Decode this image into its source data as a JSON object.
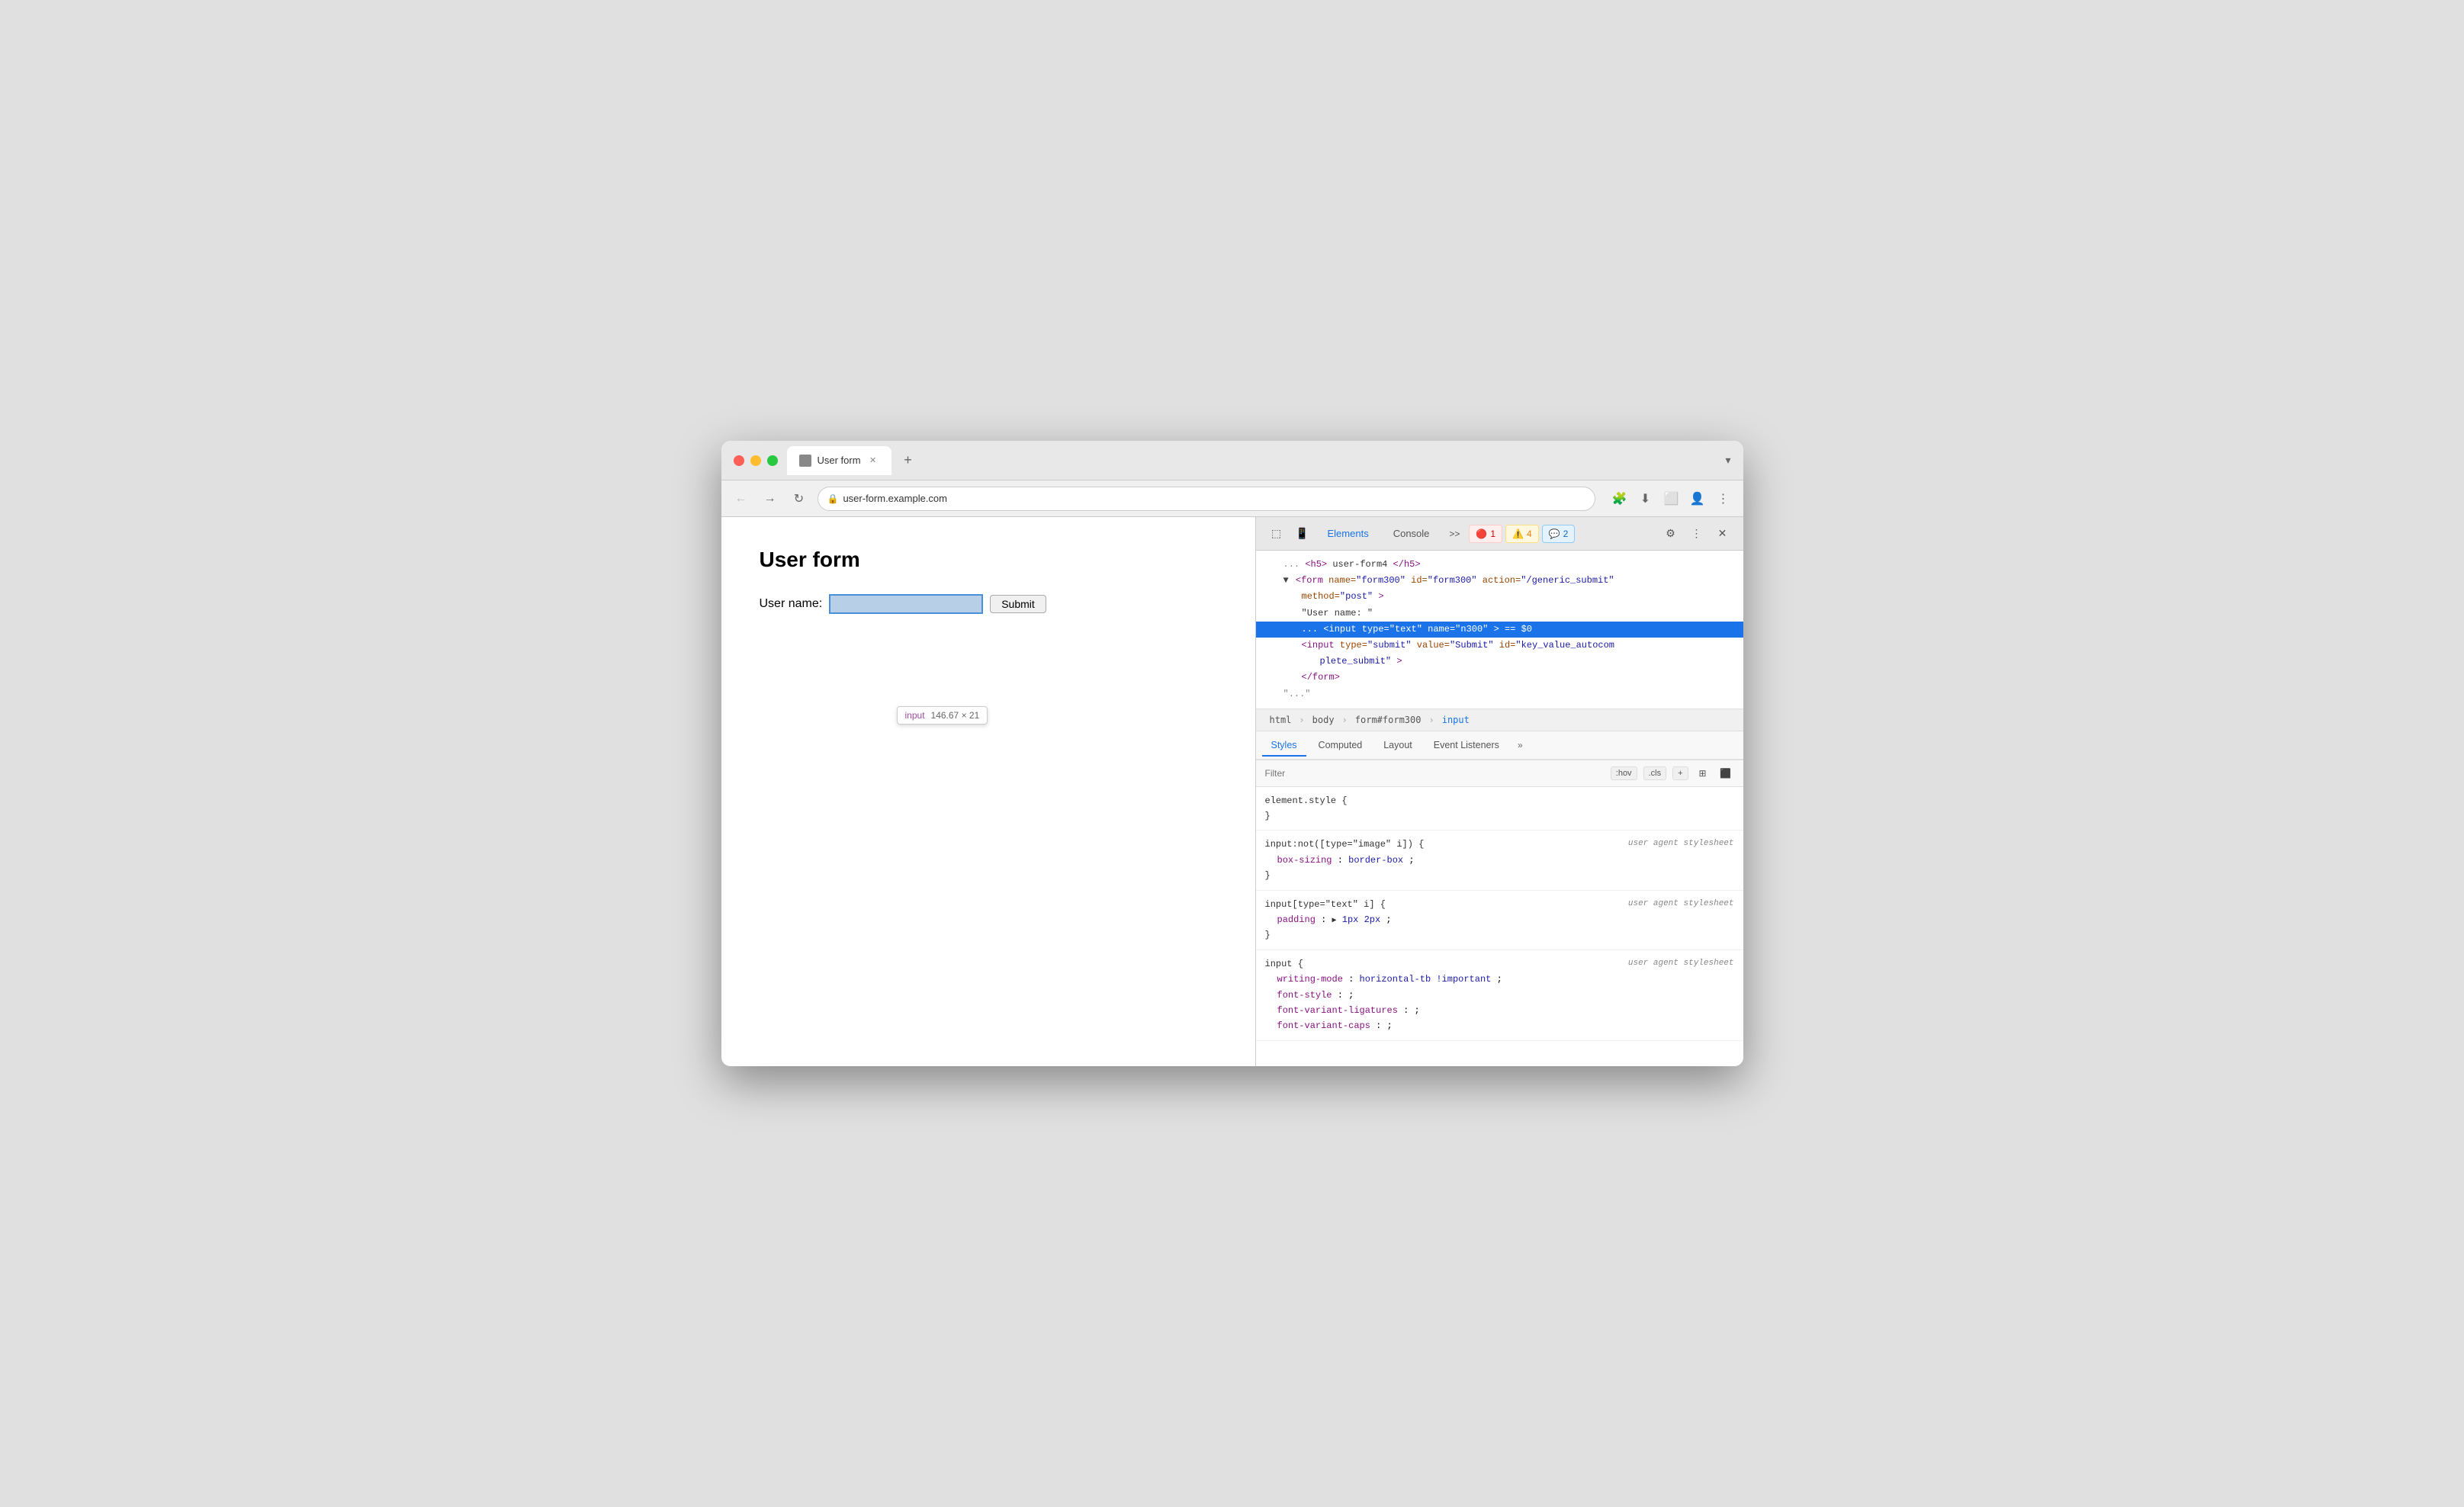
{
  "browser": {
    "tab_title": "User form",
    "tab_new_label": "+",
    "url": "user-form.example.com",
    "tab_menu_label": "▾"
  },
  "page": {
    "title": "User form",
    "form_label": "User name:",
    "submit_label": "Submit"
  },
  "tooltip": {
    "tag": "input",
    "dimensions": "146.67 × 21"
  },
  "devtools": {
    "tab_elements": "Elements",
    "tab_console": "Console",
    "badge_error_count": "1",
    "badge_warn_count": "4",
    "badge_info_count": "2",
    "more_tabs": ">>",
    "dom_lines": [
      {
        "text": "<h5> user-form4/h5>",
        "indent": 1,
        "highlighted": false
      },
      {
        "text": "▼<form name=\"form300\" id=\"form300\" action=\"/generic_submit\"",
        "indent": 1,
        "highlighted": false
      },
      {
        "text": "method=\"post\">",
        "indent": 2,
        "highlighted": false
      },
      {
        "text": "\"User name: \"",
        "indent": 2,
        "highlighted": false
      },
      {
        "text": "<input type=\"text\" name=\"n300\"> == $0",
        "indent": 2,
        "highlighted": true
      },
      {
        "text": "<input type=\"submit\" value=\"Submit\" id=\"key_value_autocom",
        "indent": 2,
        "highlighted": false
      },
      {
        "text": "plete_submit\">",
        "indent": 3,
        "highlighted": false
      },
      {
        "text": "</form>",
        "indent": 2,
        "highlighted": false
      },
      {
        "text": "\"...\"",
        "indent": 1,
        "highlighted": false
      }
    ],
    "breadcrumb": [
      "html",
      "body",
      "form#form300",
      "input"
    ],
    "subtabs": [
      "Styles",
      "Computed",
      "Layout",
      "Event Listeners"
    ],
    "filter_placeholder": "Filter",
    "filter_hov": ":hov",
    "filter_cls": ".cls",
    "css_rules": [
      {
        "selector": "element.style {",
        "close": "}",
        "origin": "",
        "props": []
      },
      {
        "selector": "input:not([type=\"image\" i]) {",
        "close": "}",
        "origin": "user agent stylesheet",
        "props": [
          {
            "name": "box-sizing",
            "value": "border-box",
            "arrow": false
          }
        ]
      },
      {
        "selector": "input[type=\"text\" i] {",
        "close": "}",
        "origin": "user agent stylesheet",
        "props": [
          {
            "name": "padding",
            "value": "1px 2px",
            "arrow": true
          }
        ]
      },
      {
        "selector": "input {",
        "close": "}",
        "origin": "user agent stylesheet",
        "props": [
          {
            "name": "writing-mode",
            "value": "horizontal-tb !important"
          },
          {
            "name": "font-style",
            "value": ";"
          },
          {
            "name": "font-variant-ligatures",
            "value": ";"
          },
          {
            "name": "font-variant-caps",
            "value": ";"
          }
        ]
      }
    ]
  }
}
